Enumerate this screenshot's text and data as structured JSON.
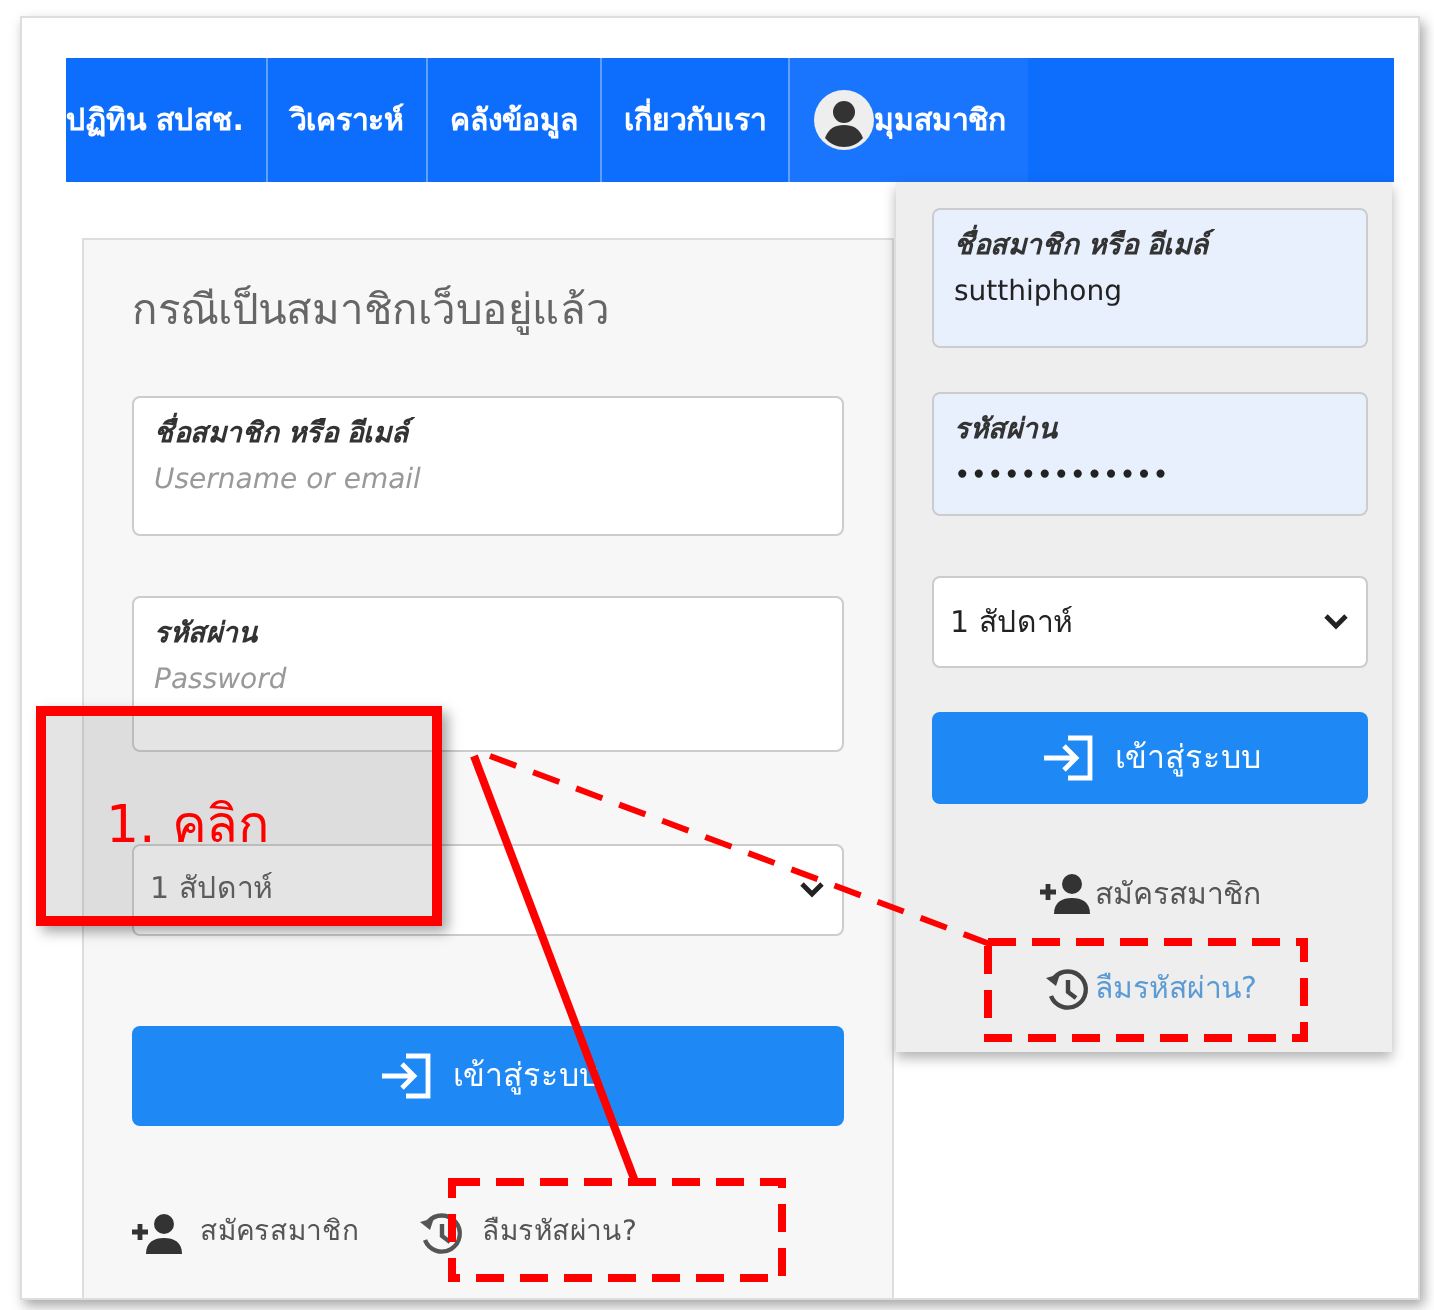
{
  "navbar": {
    "items": [
      {
        "label": "ปฏิทิน สปสช."
      },
      {
        "label": "วิเคราะห์"
      },
      {
        "label": "คลังข้อมูล"
      },
      {
        "label": "เกี่ยวกับเรา"
      }
    ],
    "member_menu": {
      "label": "มุมสมาชิก",
      "expanded": true
    }
  },
  "login_card": {
    "title": "กรณีเป็นสมาชิกเว็บอยู่แล้ว",
    "username": {
      "label": "ชื่อสมาชิก หรือ อีเมล์",
      "placeholder": "Username or email"
    },
    "password": {
      "label": "รหัสผ่าน",
      "placeholder": "Password"
    },
    "remember": "1 สัปดาห์",
    "login_button": "เข้าสู่ระบบ",
    "register_link": "สมัครสมาชิก",
    "forgot_link": "ลืมรหัสผ่าน?"
  },
  "member_dropdown": {
    "username": {
      "label": "ชื่อสมาชิก หรือ อีเมล์",
      "value": "sutthiphong"
    },
    "password": {
      "label": "รหัสผ่าน",
      "value": "•••••••••••••"
    },
    "remember": "1 สัปดาห์",
    "login_button": "เข้าสู่ระบบ",
    "register_link": "สมัครสมาชิก",
    "forgot_link": "ลืมรหัสผ่าน?"
  },
  "annotation": {
    "step_label": "1. คลิก"
  }
}
